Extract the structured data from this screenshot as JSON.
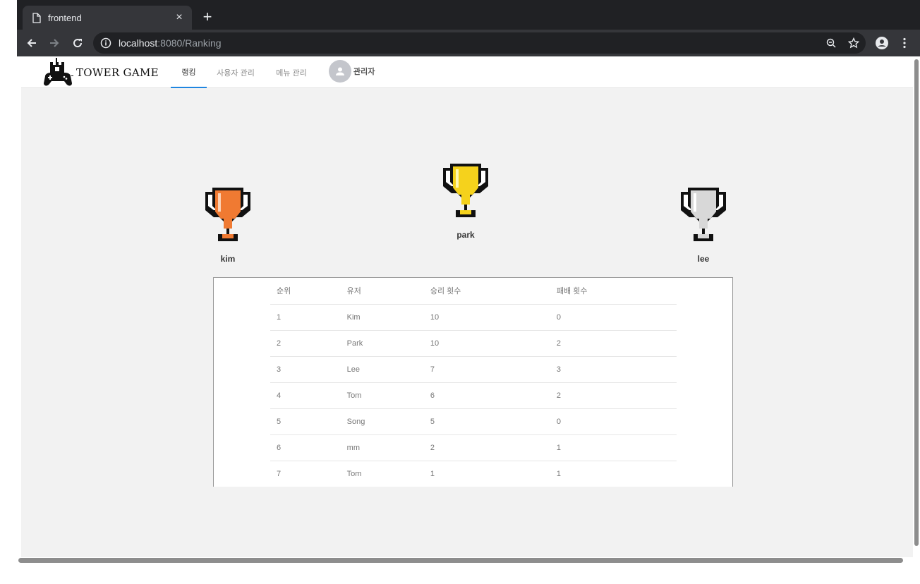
{
  "browser": {
    "tab_title": "frontend",
    "close_glyph": "×",
    "newtab_glyph": "+",
    "url_host": "localhost",
    "url_rest": ":8080/Ranking"
  },
  "app": {
    "logo_text": "TOWER GAME",
    "nav": [
      {
        "label": "랭킹",
        "active": true
      },
      {
        "label": "사용자 관리",
        "active": false
      },
      {
        "label": "메뉴 관리",
        "active": false
      }
    ],
    "user_name": "관리자"
  },
  "podium": {
    "first": {
      "name": "park",
      "rank": "1",
      "color": "#f5d21c"
    },
    "second": {
      "name": "lee",
      "rank": "2",
      "color": "#d8d8d8"
    },
    "third": {
      "name": "kim",
      "rank": "3",
      "color": "#f07a32"
    }
  },
  "ranking_table": {
    "headers": [
      "순위",
      "유저",
      "승리 횟수",
      "패배 횟수"
    ],
    "rows": [
      [
        "1",
        "Kim",
        "10",
        "0"
      ],
      [
        "2",
        "Park",
        "10",
        "2"
      ],
      [
        "3",
        "Lee",
        "7",
        "3"
      ],
      [
        "4",
        "Tom",
        "6",
        "2"
      ],
      [
        "5",
        "Song",
        "5",
        "0"
      ],
      [
        "6",
        "mm",
        "2",
        "1"
      ],
      [
        "7",
        "Tom",
        "1",
        "1"
      ]
    ]
  },
  "colors": {
    "accent": "#1f86e0",
    "page_bg": "#f2f2f2"
  }
}
